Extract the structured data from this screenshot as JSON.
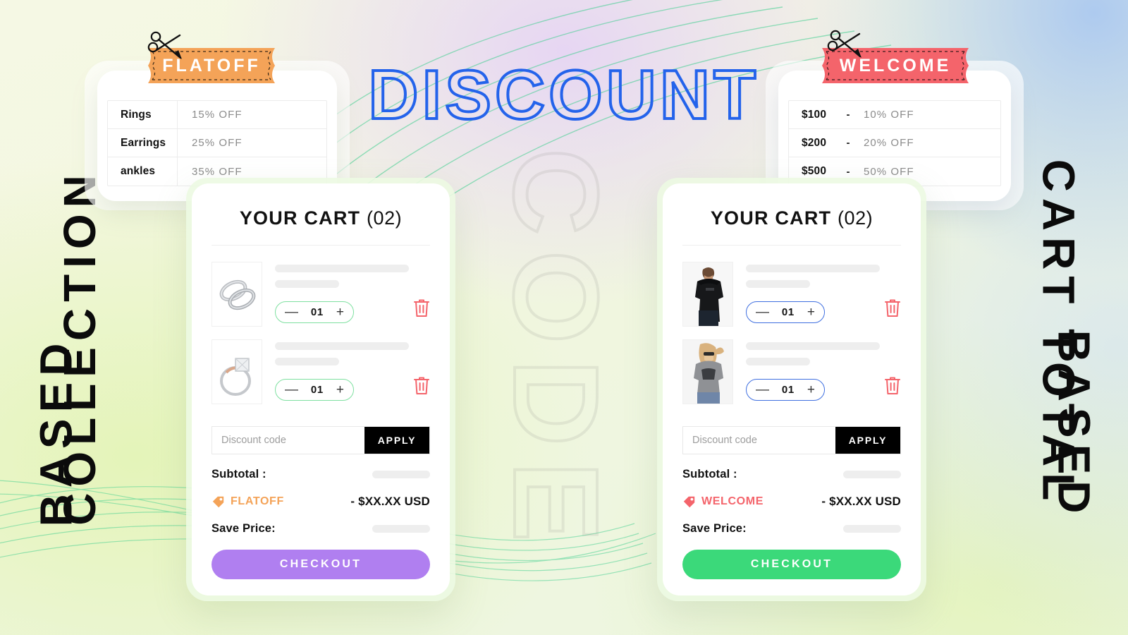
{
  "headline": "DISCOUNT",
  "watermark": "CODE",
  "side_labels": {
    "left_primary": "COLLECTION",
    "left_secondary": "BASED",
    "right_primary": "CART TOTAL",
    "right_secondary": "BASED"
  },
  "colors": {
    "headline_outline": "#2463eb",
    "flatoff": "#f4a358",
    "welcome": "#f4646b",
    "checkout_left": "#b07ff0",
    "checkout_right": "#3bd97a",
    "stepper_left_border": "#7ee0a0",
    "stepper_right_border": "#3f6fe0",
    "trash": "#f4646b",
    "apply_bg": "#000000"
  },
  "coupon_left": {
    "code": "FLATOFF",
    "rows": [
      {
        "key": "Rings",
        "dash": "",
        "value": "15% OFF"
      },
      {
        "key": "Earrings",
        "dash": "",
        "value": "25% OFF"
      },
      {
        "key": "ankles",
        "dash": "",
        "value": "35% OFF"
      }
    ]
  },
  "coupon_right": {
    "code": "WELCOME",
    "rows": [
      {
        "key": "$100",
        "dash": "-",
        "value": "10% OFF"
      },
      {
        "key": "$200",
        "dash": "-",
        "value": "20% OFF"
      },
      {
        "key": "$500",
        "dash": "-",
        "value": "50% OFF"
      }
    ]
  },
  "cart_left": {
    "title": "YOUR CART",
    "count": "(02)",
    "items": [
      {
        "qty": "01",
        "minus": "—",
        "plus": "+",
        "thumb": "silver-band-rings-photo"
      },
      {
        "qty": "01",
        "minus": "—",
        "plus": "+",
        "thumb": "rose-gold-diamond-ring-photo"
      }
    ],
    "discount_placeholder": "Discount code",
    "discount_value": "",
    "apply_label": "APPLY",
    "subtotal_label": "Subtotal :",
    "promo_code": "FLATOFF",
    "promo_amount": "- $XX.XX USD",
    "save_label": "Save Price:",
    "checkout_label": "CHECKOUT"
  },
  "cart_right": {
    "title": "YOUR CART",
    "count": "(02)",
    "items": [
      {
        "qty": "01",
        "minus": "—",
        "plus": "+",
        "thumb": "man-black-tshirt-photo"
      },
      {
        "qty": "01",
        "minus": "—",
        "plus": "+",
        "thumb": "woman-grey-tshirt-photo"
      }
    ],
    "discount_placeholder": "Discount code",
    "discount_value": "",
    "apply_label": "APPLY",
    "subtotal_label": "Subtotal :",
    "promo_code": "WELCOME",
    "promo_amount": "- $XX.XX USD",
    "save_label": "Save Price:",
    "checkout_label": "CHECKOUT"
  }
}
